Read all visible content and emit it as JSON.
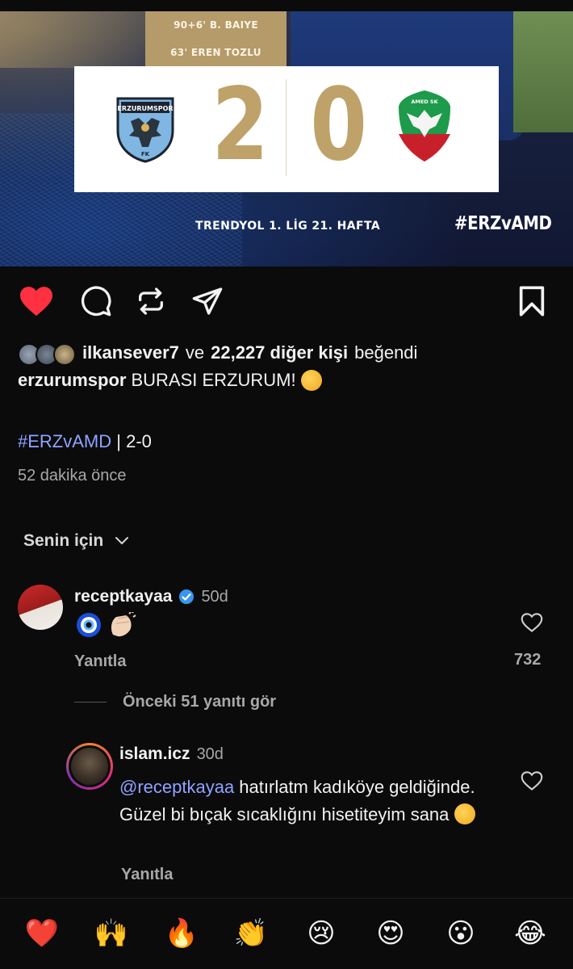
{
  "post": {
    "scorers": [
      "90+6' B. BAIYE",
      "63' EREN TOZLU"
    ],
    "home_crest_text": "ERZURUMSPOR",
    "home_crest_fk": "FK",
    "away_crest_text": "AMED SK",
    "score_home": "2",
    "score_away": "0",
    "league": "TRENDYOL 1. LİG 21. HAFTA",
    "hashtag": "#ERZvAMD"
  },
  "likes": {
    "first_user": "ilkansever7",
    "connector": "ve",
    "count_text": "22,227 diğer kişi",
    "suffix": "beğendi"
  },
  "caption": {
    "user": "erzurumspor",
    "text": "BURASI ERZURUM!",
    "hashtag": "#ERZvAMD",
    "score_text": "| 2-0"
  },
  "time_ago": "52 dakika önce",
  "sort_label": "Senin için",
  "comments": [
    {
      "user": "receptkayaa",
      "time": "50d",
      "reply_label": "Yanıtla",
      "likes": "732"
    }
  ],
  "view_previous": "Önceki 51 yanıtı gör",
  "reply": {
    "user": "islam.icz",
    "time": "30d",
    "mention": "@receptkayaa",
    "text": " hatırlatm kadıköye geldiğinde. Güzel bi bıçak sıcaklığını hisetiteyim sana",
    "reply_label": "Yanıtla"
  },
  "colors": {
    "like_red": "#ff3040",
    "link_blue": "#8fa3ff",
    "gold": "#bfa269"
  },
  "icons": [
    "heart-icon",
    "comment-icon",
    "repost-icon",
    "share-icon",
    "bookmark-icon",
    "verified-icon",
    "chevron-down-icon"
  ],
  "quick_reactions": [
    "❤️",
    "🙌",
    "🔥",
    "👏",
    "😢",
    "😍",
    "😮",
    "😂"
  ]
}
